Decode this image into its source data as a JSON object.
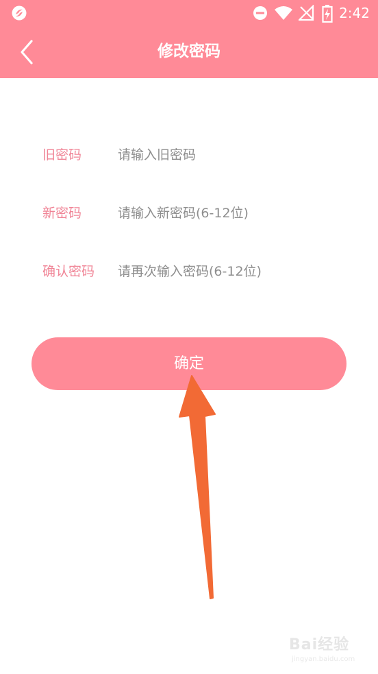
{
  "status_bar": {
    "time": "2:42",
    "icons": [
      "app-logo-icon",
      "do-not-disturb-icon",
      "wifi-icon",
      "no-signal-icon",
      "battery-charging-icon"
    ]
  },
  "header": {
    "title": "修改密码",
    "back_icon": "chevron-left-icon"
  },
  "form": {
    "fields": [
      {
        "label": "旧密码",
        "placeholder": "请输入旧密码"
      },
      {
        "label": "新密码",
        "placeholder": "请输入新密码(6-12位)"
      },
      {
        "label": "确认密码",
        "placeholder": "请再次输入密码(6-12位)"
      }
    ]
  },
  "confirm_button": {
    "label": "确定"
  },
  "watermark": {
    "brand": "Bai经验",
    "url": "jingyan.baidu.com"
  },
  "colors": {
    "primary": "#ff8a97",
    "label": "#f08496",
    "arrow": "#f26a35"
  }
}
